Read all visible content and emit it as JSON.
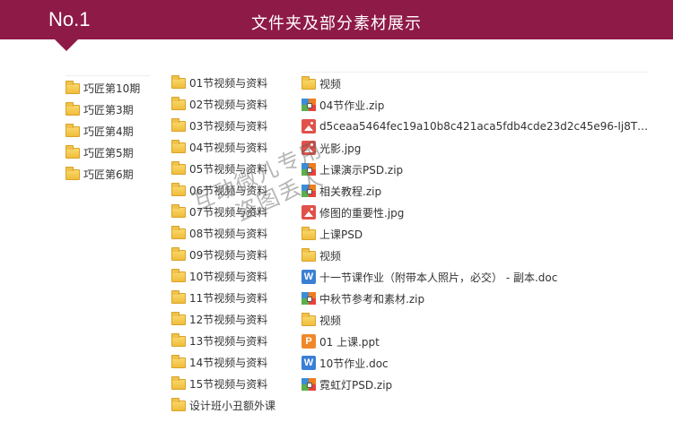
{
  "header": {
    "badge": "No.1",
    "title": "文件夹及部分素材展示",
    "color": "#8e1a47"
  },
  "column1": {
    "items": [
      {
        "label": "巧匠第10期",
        "icon": "folder-icon"
      },
      {
        "label": "巧匠第3期",
        "icon": "folder-icon"
      },
      {
        "label": "巧匠第4期",
        "icon": "folder-icon"
      },
      {
        "label": "巧匠第5期",
        "icon": "folder-icon"
      },
      {
        "label": "巧匠第6期",
        "icon": "folder-icon"
      }
    ]
  },
  "column2": {
    "items": [
      {
        "label": "01节视频与资料",
        "icon": "folder-icon"
      },
      {
        "label": "02节视频与资料",
        "icon": "folder-icon"
      },
      {
        "label": "03节视频与资料",
        "icon": "folder-icon"
      },
      {
        "label": "04节视频与资料",
        "icon": "folder-icon"
      },
      {
        "label": "05节视频与资料",
        "icon": "folder-icon"
      },
      {
        "label": "06节视频与资料",
        "icon": "folder-icon"
      },
      {
        "label": "07节视频与资料",
        "icon": "folder-icon"
      },
      {
        "label": "08节视频与资料",
        "icon": "folder-icon"
      },
      {
        "label": "09节视频与资料",
        "icon": "folder-icon"
      },
      {
        "label": "10节视频与资料",
        "icon": "folder-icon"
      },
      {
        "label": "11节视频与资料",
        "icon": "folder-icon"
      },
      {
        "label": "12节视频与资料",
        "icon": "folder-icon"
      },
      {
        "label": "13节视频与资料",
        "icon": "folder-icon"
      },
      {
        "label": "14节视频与资料",
        "icon": "folder-icon"
      },
      {
        "label": "15节视频与资料",
        "icon": "folder-icon"
      },
      {
        "label": "设计班小丑额外课",
        "icon": "folder-icon"
      }
    ]
  },
  "column3": {
    "items": [
      {
        "label": "视频",
        "icon": "folder-icon"
      },
      {
        "label": "04节作业.zip",
        "icon": "zip-icon"
      },
      {
        "label": "d5ceaa5464fec19a10b8c421aca5fdb4cde23d2c45e96-Ij8TN...",
        "icon": "image-icon"
      },
      {
        "label": "光影.jpg",
        "icon": "image-icon"
      },
      {
        "label": "上课演示PSD.zip",
        "icon": "zip-icon"
      },
      {
        "label": "相关教程.zip",
        "icon": "zip-icon"
      },
      {
        "label": "修图的重要性.jpg",
        "icon": "image-icon"
      },
      {
        "label": "上课PSD",
        "icon": "folder-icon"
      },
      {
        "label": "视频",
        "icon": "folder-icon"
      },
      {
        "label": "十一节课作业（附带本人照片，必交） - 副本.doc",
        "icon": "word-doc-icon"
      },
      {
        "label": "中秋节参考和素材.zip",
        "icon": "zip-icon"
      },
      {
        "label": "视频",
        "icon": "folder-icon"
      },
      {
        "label": "01 上课.ppt",
        "icon": "ppt-icon"
      },
      {
        "label": "10节作业.doc",
        "icon": "word-doc-icon"
      },
      {
        "label": "霓虹灯PSD.zip",
        "icon": "zip-icon"
      }
    ]
  },
  "watermark": {
    "line1": "互动微儿专用",
    "line2": "盗图丢人"
  }
}
